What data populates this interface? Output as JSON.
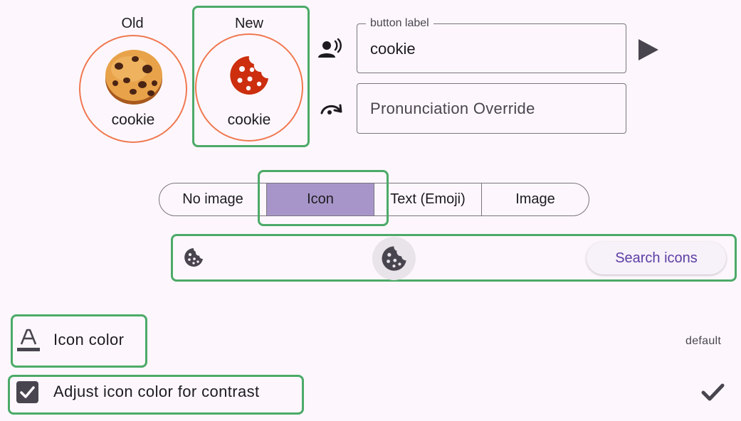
{
  "preview": {
    "old": {
      "heading": "Old",
      "label": "cookie",
      "image": "cookie-emoji-image"
    },
    "new": {
      "heading": "New",
      "label": "cookie",
      "image": "cookie-icon"
    }
  },
  "fields": {
    "button_label": {
      "legend": "button label",
      "value": "cookie",
      "icon": "voice-icon"
    },
    "pronunciation": {
      "placeholder": "Pronunciation Override",
      "icon": "redo-arc-icon"
    },
    "play_icon": "play-icon"
  },
  "image_type": {
    "options": [
      "No image",
      "Icon",
      "Text (Emoji)",
      "Image"
    ],
    "selected": "Icon"
  },
  "icon_picker": {
    "small_icon": "cookie-icon",
    "current_icon": "cookie-icon",
    "search_label": "Search icons"
  },
  "icon_color": {
    "label": "Icon color",
    "value": "default",
    "icon": "text-color-icon"
  },
  "contrast": {
    "label": "Adjust icon color for contrast",
    "checked": true,
    "trailing_icon": "check-icon"
  },
  "colors": {
    "accent": "#a795c9",
    "highlight_border": "#4caa68",
    "circle_border": "#f07850",
    "icon_red": "#cc2e0e",
    "icon_dark": "#49454f",
    "button_text": "#5b3ea5"
  }
}
